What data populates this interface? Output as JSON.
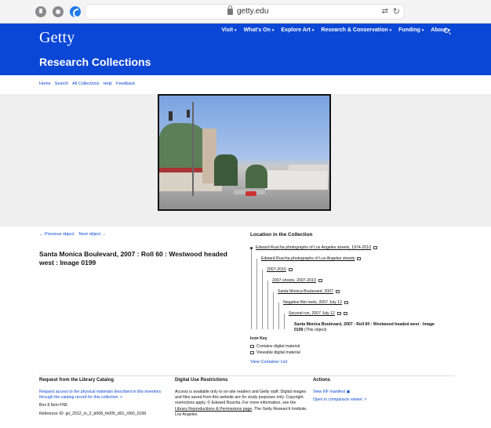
{
  "browser": {
    "url": "getty.edu"
  },
  "header": {
    "logo": "Getty",
    "nav": [
      "Visit",
      "What's On",
      "Explore Art",
      "Research & Conservation",
      "Funding",
      "About"
    ],
    "title": "Research Collections"
  },
  "subnav": [
    "Home",
    "Search",
    "All Collections",
    "Help",
    "Feedback"
  ],
  "pager": {
    "prev": "← Previous object",
    "next": "Next object →"
  },
  "object_title": "Santa Monica Boulevard, 2007 : Roll 60 : Westwood headed west : Image 0199",
  "location": {
    "heading": "Location in the Collection",
    "nodes": [
      "Edward Ruscha photographs of Los Angeles streets, 1974-2010",
      "Edward Ruscha photographs of Los Angeles streets",
      "2007-2010",
      "2007 shoots, 2007-2010",
      "Santa Monica Boulevard, 2007",
      "Negative film reels, 2007 July 12",
      "Second run, 2007 July 12"
    ],
    "current": "Santa Monica Boulevard, 2007 : Roll 60 : Westwood headed west : Image 0199",
    "current_note": "(This object)"
  },
  "icon_key": {
    "heading": "Icon Key",
    "items": [
      "Contains digital material",
      "Viewable digital material"
    ]
  },
  "view_container": "View Container List",
  "footer": {
    "request": {
      "heading": "Request from the Library Catalog",
      "link": "Request access to the physical materials described in this inventory through the catalog record for this collection ↗",
      "box": "Box 8 Item FN5",
      "ref": "Reference ID: gri_2012_m_2_b008_fn005_d01_r060_0199"
    },
    "usage": {
      "heading": "Digital Use Restrictions",
      "text": "Access is available only to on-site readers and Getty staff. Digital images and files saved from this website are for study purposes only. Copyright restrictions apply. © Edward Ruscha. For more information, see the",
      "link": "Library Reproductions & Permissions page",
      "tail": ". The Getty Research Institute, Los Angeles."
    },
    "actions": {
      "heading": "Actions",
      "iiif": "View IIIF manifest",
      "compare": "Open in comparison viewer ↗"
    }
  }
}
